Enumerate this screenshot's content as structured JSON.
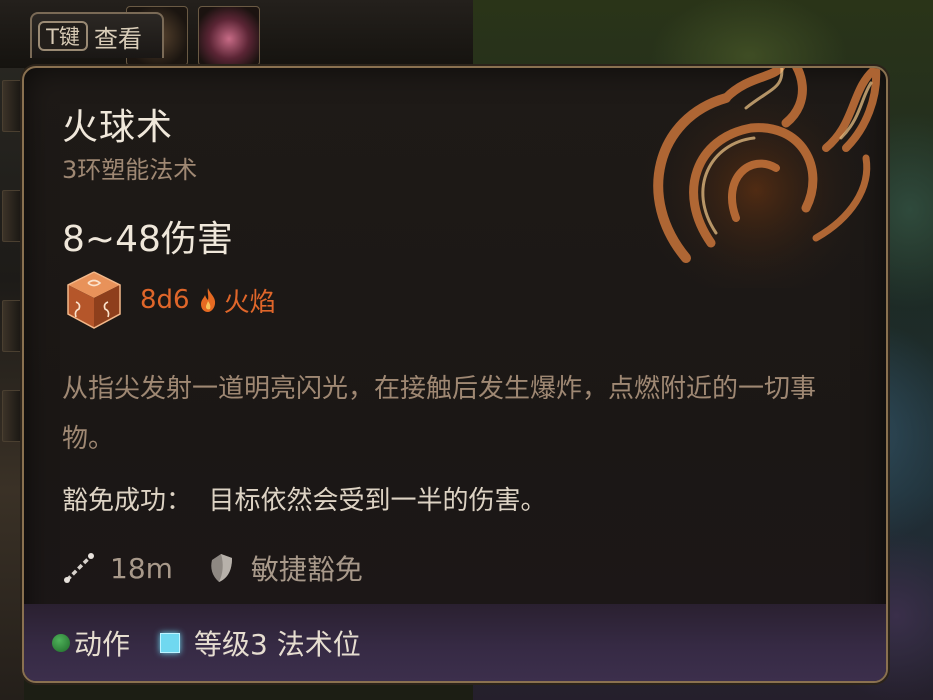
{
  "key_hint": {
    "key": "T键",
    "label": "查看"
  },
  "spell": {
    "name": "火球术",
    "subtitle": "3环塑能法术",
    "damage_total": "8~48伤害",
    "dice": {
      "formula": "8d6",
      "damage_type": "火焰",
      "color": "#e0662a"
    },
    "description": "从指尖发射一道明亮闪光，在接触后发生爆炸，点燃附近的一切事物。",
    "save_success": "豁免成功：  目标依然会受到一半的伤害。",
    "range": "18m",
    "save_type": "敏捷豁免"
  },
  "footer": {
    "action_label": "动作",
    "action_color": "#3a9a48",
    "slot_label": "等级3 法术位",
    "slot_color": "#6fd8f0"
  },
  "icons": {
    "spell_art": "fireball-icon",
    "dice": "d6-dice-icon",
    "flame": "flame-icon",
    "range": "range-icon",
    "save": "shield-icon"
  }
}
